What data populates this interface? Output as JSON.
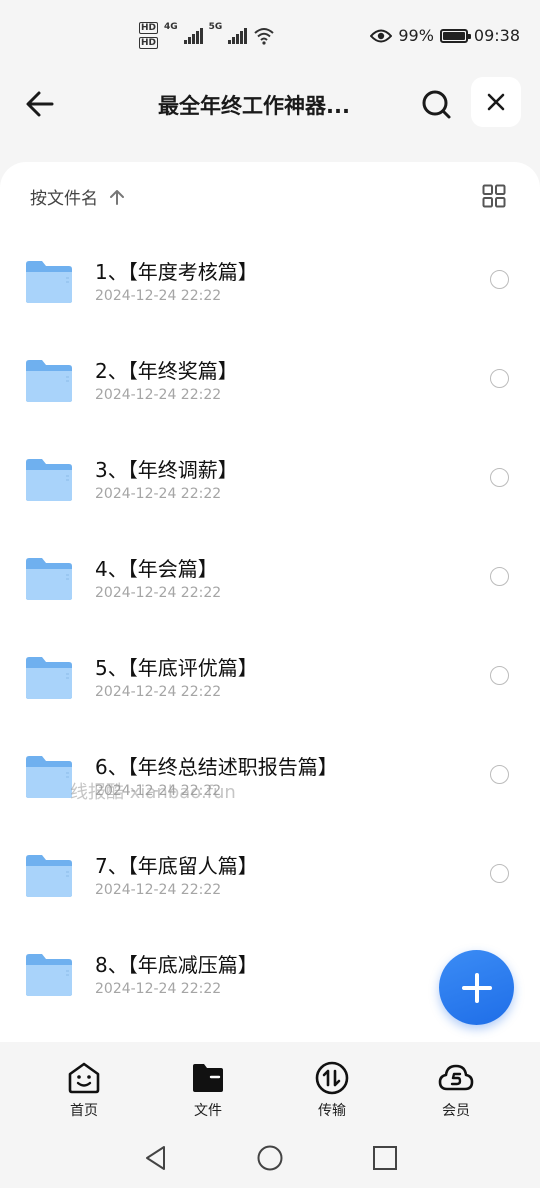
{
  "status_bar": {
    "hd_top": "HD",
    "hd_bottom": "HD",
    "net1": "4G",
    "net2": "5G",
    "battery_percent": "99%",
    "battery_level": 0.99,
    "time": "09:38"
  },
  "header": {
    "title": "最全年终工作神器..."
  },
  "sort": {
    "label": "按文件名"
  },
  "files": [
    {
      "name": "1、【年度考核篇】",
      "date": "2024-12-24 22:22"
    },
    {
      "name": "2、【年终奖篇】",
      "date": "2024-12-24 22:22"
    },
    {
      "name": "3、【年终调薪】",
      "date": "2024-12-24 22:22"
    },
    {
      "name": "4、【年会篇】",
      "date": "2024-12-24 22:22"
    },
    {
      "name": "5、【年底评优篇】",
      "date": "2024-12-24 22:22"
    },
    {
      "name": "6、【年终总结述职报告篇】",
      "date": "2024-12-24 22:22"
    },
    {
      "name": "7、【年底留人篇】",
      "date": "2024-12-24 22:22"
    },
    {
      "name": "8、【年底减压篇】",
      "date": "2024-12-24 22:22"
    }
  ],
  "watermark": "线报酷 xianbao.fun",
  "bottom_nav": {
    "home": "首页",
    "files": "文件",
    "transfer": "传输",
    "vip": "会员"
  },
  "colors": {
    "accent": "#1f6ee8",
    "folder": "#8ec3f5"
  }
}
